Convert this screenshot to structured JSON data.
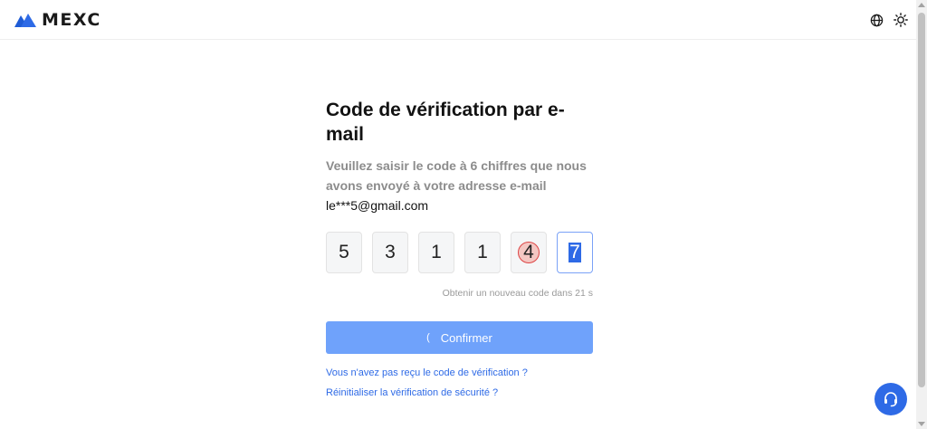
{
  "header": {
    "brand": "MEXC",
    "icons": [
      "globe-icon",
      "sun-icon"
    ]
  },
  "verification": {
    "title": "Code de vérification par e-mail",
    "description": "Veuillez saisir le code à 6 chiffres que nous avons envoyé à votre adresse e-mail",
    "email": "le***5@gmail.com",
    "digits": [
      "5",
      "3",
      "1",
      "1",
      "4",
      "7"
    ],
    "resend_text": "Obtenir un nouveau code dans 21 s",
    "confirm_label": "Confirmer",
    "spinner_glyph": "(",
    "link_not_received": "Vous n'avez pas reçu le code de vérification ?",
    "link_reset": "Réinitialiser la vérification de sécurité ?"
  },
  "colors": {
    "accent": "#2e6ae6",
    "button": "#6fa2fb",
    "logo_blue": "#1f5cd6"
  }
}
